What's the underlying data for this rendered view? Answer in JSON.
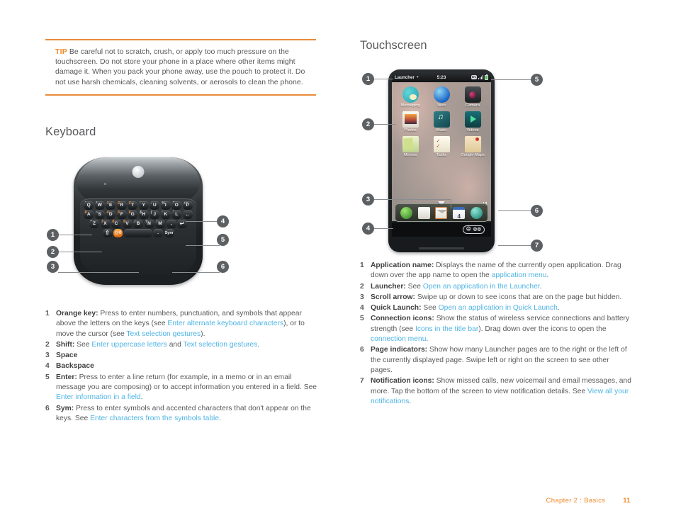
{
  "tip": {
    "label": "TIP",
    "text": "Be careful not to scratch, crush, or apply too much pressure on the touchscreen. Do not store your phone in a place where other items might damage it. When you pack your phone away, use the pouch to protect it. Do not use harsh chemicals, cleaning solvents, or aerosols to clean the phone."
  },
  "keyboard_section": {
    "heading": "Keyboard",
    "callouts": [
      "1",
      "2",
      "3",
      "4",
      "5",
      "6"
    ],
    "legend": [
      {
        "num": "1",
        "term": "Orange key:",
        "parts": [
          {
            "t": "Press to enter numbers, punctuation, and symbols that appear above the letters on the keys (see ",
            "link": false
          },
          {
            "t": "Enter alternate keyboard characters",
            "link": true
          },
          {
            "t": "), or to move the cursor (see ",
            "link": false
          },
          {
            "t": "Text selection gestures",
            "link": true
          },
          {
            "t": ").",
            "link": false
          }
        ]
      },
      {
        "num": "2",
        "term": "Shift:",
        "parts": [
          {
            "t": "See ",
            "link": false
          },
          {
            "t": "Enter uppercase letters",
            "link": true
          },
          {
            "t": " and ",
            "link": false
          },
          {
            "t": "Text selection gestures",
            "link": true
          },
          {
            "t": ".",
            "link": false
          }
        ]
      },
      {
        "num": "3",
        "term": "Space",
        "parts": []
      },
      {
        "num": "4",
        "term": "Backspace",
        "parts": []
      },
      {
        "num": "5",
        "term": "Enter:",
        "parts": [
          {
            "t": "Press to enter a line return (for example, in a memo or in an email message you are composing) or to accept information you entered in a field. See ",
            "link": false
          },
          {
            "t": "Enter information in a field",
            "link": true
          },
          {
            "t": ".",
            "link": false
          }
        ]
      },
      {
        "num": "6",
        "term": "Sym:",
        "parts": [
          {
            "t": "Press to enter symbols and accented characters that don't appear on the keys. See ",
            "link": false
          },
          {
            "t": "Enter characters from the symbols table",
            "link": true
          },
          {
            "t": ".",
            "link": false
          }
        ]
      }
    ],
    "keys": {
      "row1": [
        {
          "alt": "'",
          "altcolor": "white",
          "label": "Q"
        },
        {
          "alt": "*",
          "altcolor": "white",
          "label": "W"
        },
        {
          "alt": "1",
          "altcolor": "orange",
          "label": "E"
        },
        {
          "alt": "2",
          "altcolor": "orange",
          "label": "R"
        },
        {
          "alt": "3",
          "altcolor": "orange",
          "label": "T"
        },
        {
          "alt": "'",
          "altcolor": "white",
          "label": "Y"
        },
        {
          "alt": "-",
          "altcolor": "white",
          "label": "U"
        },
        {
          "alt": "%",
          "altcolor": "white",
          "label": "I"
        },
        {
          "alt": "\"",
          "altcolor": "white",
          "label": "O"
        },
        {
          "alt": "+=",
          "altcolor": "white",
          "label": "P"
        }
      ],
      "row2": [
        {
          "alt": "8",
          "altcolor": "orange",
          "label": "A"
        },
        {
          "alt": "~",
          "altcolor": "white",
          "label": "S"
        },
        {
          "alt": "4",
          "altcolor": "orange",
          "label": "D"
        },
        {
          "alt": "5",
          "altcolor": "orange",
          "label": "F"
        },
        {
          "alt": "6",
          "altcolor": "orange",
          "label": "G"
        },
        {
          "alt": "$",
          "altcolor": "white",
          "label": "H"
        },
        {
          "alt": "|",
          "altcolor": "white",
          "label": "J"
        },
        {
          "alt": "'",
          "altcolor": "white",
          "label": "K"
        },
        {
          "alt": "'",
          "altcolor": "white",
          "label": "L"
        },
        {
          "alt": "",
          "altcolor": "white",
          "label": "←"
        }
      ],
      "row3": [
        {
          "alt": "*",
          "altcolor": "white",
          "label": "Z"
        },
        {
          "alt": "7",
          "altcolor": "orange",
          "label": "X"
        },
        {
          "alt": "8",
          "altcolor": "orange",
          "label": "C"
        },
        {
          "alt": "9",
          "altcolor": "orange",
          "label": "V"
        },
        {
          "alt": "/",
          "altcolor": "white",
          "label": "B"
        },
        {
          "alt": "?",
          "altcolor": "white",
          "label": "N"
        },
        {
          "alt": "!",
          "altcolor": "white",
          "label": "M"
        },
        {
          "alt": "",
          "altcolor": "white",
          "label": ","
        },
        {
          "alt": "",
          "altcolor": "white",
          "label": "↵"
        }
      ],
      "row4": [
        {
          "label": "⇧",
          "type": "shift"
        },
        {
          "label": "@0",
          "type": "orange"
        },
        {
          "label": "",
          "type": "space"
        },
        {
          "label": ".",
          "type": "period"
        },
        {
          "label": "Sym",
          "type": "sym"
        }
      ]
    }
  },
  "touchscreen_section": {
    "heading": "Touchscreen",
    "callouts": [
      "1",
      "2",
      "3",
      "4",
      "5",
      "6",
      "7"
    ],
    "phone": {
      "title_bar": {
        "app_name": "Launcher",
        "time": "5:23",
        "network_label": "Ev"
      },
      "apps": [
        [
          {
            "label": "Messaging",
            "icon": "messaging-icon"
          },
          {
            "label": "Web",
            "icon": "web-icon"
          },
          {
            "label": "Camera",
            "icon": "camera-icon"
          }
        ],
        [
          {
            "label": "Photos",
            "icon": "photos-icon"
          },
          {
            "label": "Music",
            "icon": "music-icon"
          },
          {
            "label": "Videos",
            "icon": "videos-icon"
          }
        ],
        [
          {
            "label": "Memos",
            "icon": "memos-icon"
          },
          {
            "label": "Tasks",
            "icon": "tasks-icon"
          },
          {
            "label": "Google Maps",
            "icon": "google-maps-icon"
          }
        ]
      ],
      "quick_launch": [
        {
          "icon": "phone-icon"
        },
        {
          "icon": "contacts-icon"
        },
        {
          "icon": "email-icon"
        },
        {
          "icon": "calendar-icon",
          "label": "4"
        },
        {
          "icon": "launcher-icon"
        }
      ],
      "notifications": [
        {
          "icon": "missed-call-icon"
        },
        {
          "icon": "voicemail-icon"
        }
      ]
    },
    "legend": [
      {
        "num": "1",
        "term": "Application name:",
        "parts": [
          {
            "t": "Displays the name of the currently open application. Drag down over the app name to open the ",
            "link": false
          },
          {
            "t": "application menu",
            "link": true
          },
          {
            "t": ".",
            "link": false
          }
        ]
      },
      {
        "num": "2",
        "term": "Launcher:",
        "parts": [
          {
            "t": "See ",
            "link": false
          },
          {
            "t": "Open an application in the Launcher",
            "link": true
          },
          {
            "t": ".",
            "link": false
          }
        ]
      },
      {
        "num": "3",
        "term": "Scroll arrow:",
        "parts": [
          {
            "t": "Swipe up or down to see icons that are on the page but hidden.",
            "link": false
          }
        ]
      },
      {
        "num": "4",
        "term": "Quick Launch:",
        "parts": [
          {
            "t": "See ",
            "link": false
          },
          {
            "t": "Open an application in Quick Launch",
            "link": true
          },
          {
            "t": ".",
            "link": false
          }
        ]
      },
      {
        "num": "5",
        "term": "Connection icons:",
        "parts": [
          {
            "t": "Show the status of wireless service connections and battery strength (see ",
            "link": false
          },
          {
            "t": "Icons in the title bar",
            "link": true
          },
          {
            "t": "). Drag down over the icons to open the ",
            "link": false
          },
          {
            "t": "connection menu",
            "link": true
          },
          {
            "t": ".",
            "link": false
          }
        ]
      },
      {
        "num": "6",
        "term": "Page indicators:",
        "parts": [
          {
            "t": "Show how many Launcher pages are to the right or the left of the currently displayed page. Swipe left or right on the screen to see other pages.",
            "link": false
          }
        ]
      },
      {
        "num": "7",
        "term": "Notification icons:",
        "parts": [
          {
            "t": "Show missed calls, new voicemail and email messages, and more. Tap the bottom of the screen to view notification details. See ",
            "link": false
          },
          {
            "t": "View all your notifications",
            "link": true
          },
          {
            "t": ".",
            "link": false
          }
        ]
      }
    ]
  },
  "footer": {
    "chapter": "Chapter 2  :  Basics",
    "page_number": "11"
  },
  "colors": {
    "accent_orange": "#f08a2b",
    "link_blue": "#4fb4e4",
    "body_gray": "#58595b",
    "callout_gray": "#5d6062"
  }
}
